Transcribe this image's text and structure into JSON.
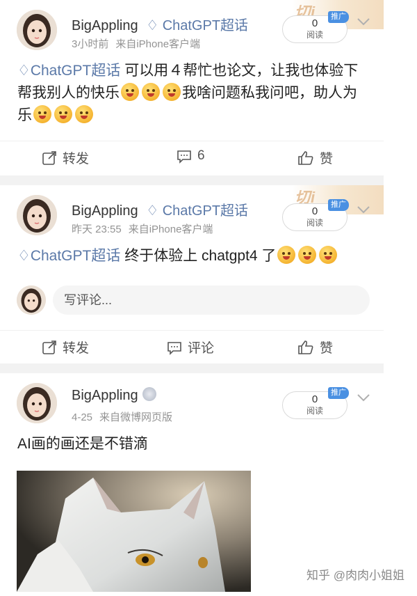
{
  "posts": [
    {
      "username": "BigAppling",
      "topic": "ChatGPT超话",
      "time": "3小时前",
      "source": "来自iPhone客户端",
      "read_count": "0",
      "read_label": "阅读",
      "ad_badge": "推广",
      "tag": "ChatGPT超话",
      "text1": " 可以用４帮忙也论文，让我也体验下帮我别人的快乐",
      "text2": "我啥问题私我问吧，助人为乐",
      "repost_label": "转发",
      "comment_label": "6",
      "like_label": "赞"
    },
    {
      "username": "BigAppling",
      "topic": "ChatGPT超话",
      "time": "昨天 23:55",
      "source": "来自iPhone客户端",
      "read_count": "0",
      "read_label": "阅读",
      "ad_badge": "推广",
      "tag": "ChatGPT超话",
      "text1": " 终于体验上 chatgpt4 了",
      "comment_placeholder": "写评论...",
      "repost_label": "转发",
      "comment_label": "评论",
      "like_label": "赞"
    },
    {
      "username": "BigAppling",
      "time": "4-25",
      "source": "来自微博网页版",
      "read_count": "0",
      "read_label": "阅读",
      "ad_badge": "推广",
      "text1": "AI画的画还是不错滴"
    }
  ],
  "watermark": "知乎 @肉肉小姐姐",
  "colors": {
    "link": "#5b79a8",
    "badge": "#4a90e2",
    "separator": "#f2f2f2"
  }
}
